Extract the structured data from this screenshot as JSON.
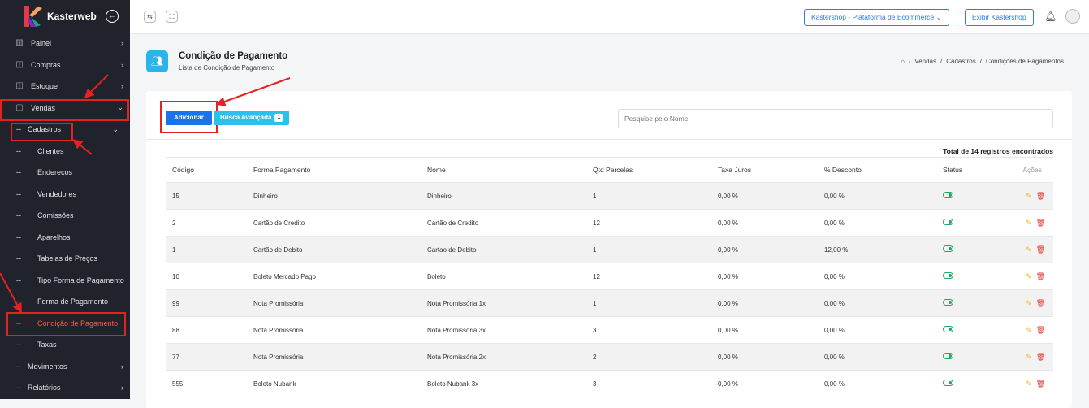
{
  "sidebar": {
    "brand": "Kasterweb",
    "items": [
      {
        "label": "Painel",
        "icon": "bar-chart-icon"
      },
      {
        "label": "Compras",
        "icon": "box-icon"
      },
      {
        "label": "Estoque",
        "icon": "box-icon"
      },
      {
        "label": "Vendas",
        "icon": "bag-icon"
      }
    ],
    "cadastros": {
      "prefix": "--",
      "label": "Cadastros"
    },
    "sub_items": [
      {
        "prefix": "--",
        "label": "Clientes"
      },
      {
        "prefix": "--",
        "label": "Endereços"
      },
      {
        "prefix": "--",
        "label": "Vendedores"
      },
      {
        "prefix": "--",
        "label": "Comissões"
      },
      {
        "prefix": "--",
        "label": "Aparelhos"
      },
      {
        "prefix": "--",
        "label": "Tabelas de Preços"
      },
      {
        "prefix": "--",
        "label": "Tipo Forma de Pagamento"
      },
      {
        "prefix": "--",
        "label": "Forma de Pagamento"
      },
      {
        "prefix": "--",
        "label": "Condição de Pagamento"
      },
      {
        "prefix": "--",
        "label": "Taxas"
      }
    ],
    "bottom_items": [
      {
        "prefix": "--",
        "label": "Movimentos"
      },
      {
        "prefix": "--",
        "label": "Relatórios"
      }
    ]
  },
  "topbar": {
    "platform_select": "Kastershop - Plataforma de Ecommerce",
    "show_button": "Exibir Kastershop"
  },
  "page": {
    "title": "Condição de Pagamento",
    "subtitle": "Lista de Condição de Pagamento",
    "breadcrumb": [
      "Vendas",
      "Cadastros",
      "Condições de Pagamentos"
    ],
    "add_button": "Adicionar",
    "advanced_search": "Busca Avançada",
    "advanced_badge": "1",
    "search_placeholder": "Pesquise pelo Nome",
    "total_text": "Total de 14 registros encontrados"
  },
  "table": {
    "headers": [
      "Código",
      "Forma Pagamento",
      "Nome",
      "Qtd Parcelas",
      "Taxa Juros",
      "% Desconto",
      "Status",
      "Ações"
    ],
    "rows": [
      [
        "15",
        "Dinheiro",
        "Dinheiro",
        "1",
        "0,00 %",
        "0,00 %"
      ],
      [
        "2",
        "Cartão de Credito",
        "Cartão de Credito",
        "12",
        "0,00 %",
        "0,00 %"
      ],
      [
        "1",
        "Cartão de Debito",
        "Cartao de Debito",
        "1",
        "0,00 %",
        "12,00 %"
      ],
      [
        "10",
        "Boleto Mercado Pago",
        "Boleto",
        "12",
        "0,00 %",
        "0,00 %"
      ],
      [
        "99",
        "Nota Promissória",
        "Nota Promissória 1x",
        "1",
        "0,00 %",
        "0,00 %"
      ],
      [
        "88",
        "Nota Promissória",
        "Nota Promissória 3x",
        "3",
        "0,00 %",
        "0,00 %"
      ],
      [
        "77",
        "Nota Promissória",
        "Nota Promissória 2x",
        "2",
        "0,00 %",
        "0,00 %"
      ],
      [
        "555",
        "Boleto Nubank",
        "Boleto Nubank 3x",
        "3",
        "0,00 %",
        "0,00 %"
      ]
    ]
  },
  "colors": {
    "sidebar_bg": "#20232b",
    "accent": "#1a73e8",
    "active_menu": "#ff5a4d",
    "annotation_red": "#e52222",
    "status_green": "#1fa860"
  }
}
